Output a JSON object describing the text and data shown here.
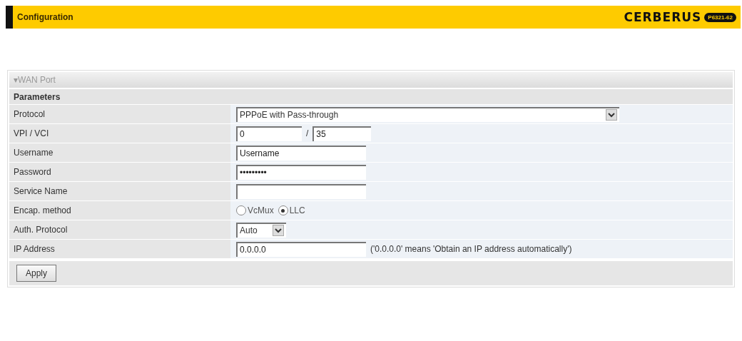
{
  "header": {
    "title": "Configuration",
    "logo": "CERBERUS",
    "model": "P6321-62"
  },
  "section": {
    "marker": "▾",
    "title": "WAN Port",
    "group": "Parameters",
    "rows": [
      {
        "kind": "select",
        "label": "Protocol",
        "value": "PPPoE with Pass-through",
        "wide": true
      },
      {
        "kind": "pair",
        "label": "VPI / VCI",
        "first": "0",
        "separator": "/",
        "second": "35"
      },
      {
        "kind": "text",
        "label": "Username",
        "value": "Username"
      },
      {
        "kind": "text",
        "label": "Password",
        "value": "•••••••••"
      },
      {
        "kind": "text",
        "label": "Service Name",
        "value": ""
      },
      {
        "kind": "radio",
        "label": "Encap. method",
        "options": [
          {
            "label": "VcMux",
            "selected": false
          },
          {
            "label": "LLC",
            "selected": true
          }
        ]
      },
      {
        "kind": "select",
        "label": "Auth. Protocol",
        "value": "Auto",
        "wide": false
      },
      {
        "kind": "text",
        "label": "IP Address",
        "value": "0.0.0.0",
        "note": "('0.0.0.0' means 'Obtain an IP address automatically')"
      }
    ],
    "button": "Apply"
  }
}
